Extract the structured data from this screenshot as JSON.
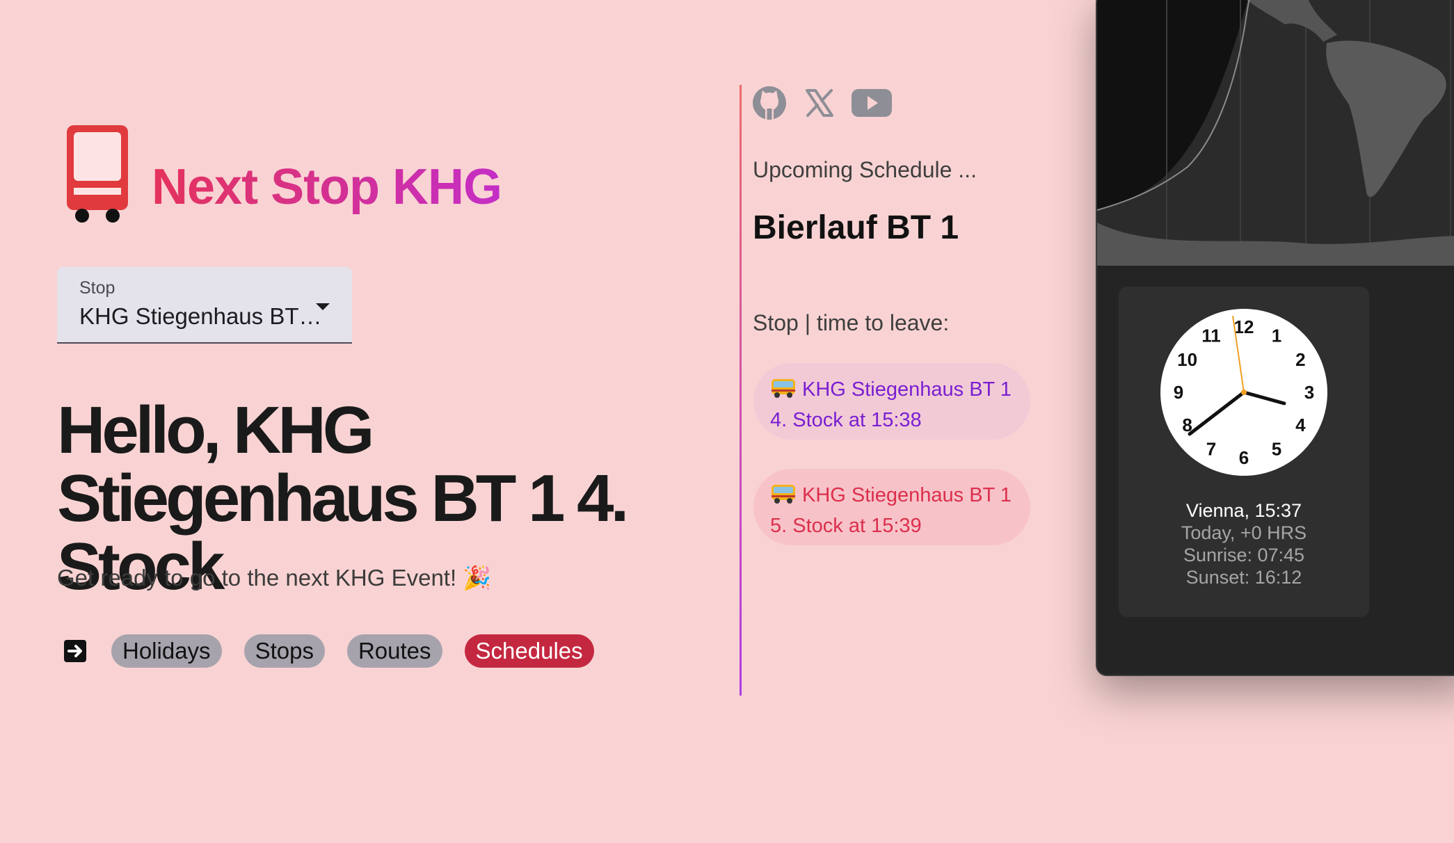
{
  "app": {
    "brand": "Next Stop KHG",
    "colors": {
      "background": "#f9d3d3",
      "accent": "#c42840",
      "brand_start": "#e5335b",
      "brand_end": "#c42ec7"
    }
  },
  "stop_select": {
    "label": "Stop",
    "value": "KHG Stiegenhaus BT…"
  },
  "hero": {
    "greeting": "Hello, KHG Stiegenhaus BT 1 4. Stock",
    "subtitle": "Get ready to go to the next KHG Event! 🎉"
  },
  "nav": {
    "icon": "arrow-right-box-icon",
    "items": [
      {
        "label": "Holidays",
        "active": false
      },
      {
        "label": "Stops",
        "active": false
      },
      {
        "label": "Routes",
        "active": false
      },
      {
        "label": "Schedules",
        "active": true
      }
    ]
  },
  "social": {
    "icons": [
      "github-icon",
      "x-icon",
      "youtube-icon"
    ]
  },
  "schedule": {
    "heading": "Upcoming Schedule ...",
    "event": "Bierlauf BT 1",
    "list_heading": "Stop | time to leave:",
    "items": [
      {
        "line1": "KHG Stiegenhaus BT 1",
        "line2": "4. Stock at 15:38"
      },
      {
        "line1": "KHG Stiegenhaus BT 1",
        "line2": "5. Stock at 15:39"
      }
    ]
  },
  "clock": {
    "numbers": [
      "12",
      "1",
      "2",
      "3",
      "4",
      "5",
      "6",
      "7",
      "8",
      "9",
      "10",
      "11"
    ],
    "city_time": "Vienna, 15:37",
    "offset": "Today, +0 HRS",
    "sunrise": "Sunrise: 07:45",
    "sunset": "Sunset: 16:12"
  }
}
